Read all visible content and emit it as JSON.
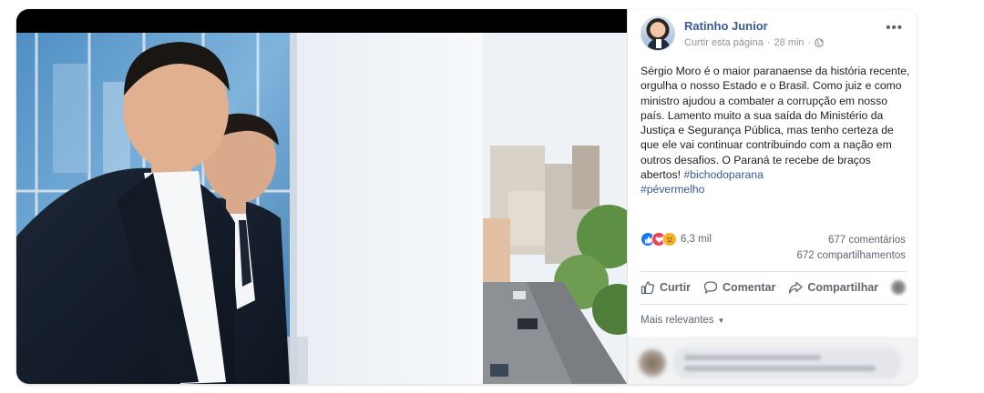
{
  "post": {
    "author": "Ratinho Junior",
    "like_page": "Curtir esta página",
    "separator": "·",
    "time": "28 min",
    "separator2": "·",
    "more_icon": "more-dots-icon",
    "text": "Sérgio Moro é o maior paranaense da história recente, orgulha o nosso Estado e o Brasil. Como juiz e como ministro ajudou a combater a corrupção em nosso país. Lamento muito a sua saída do Ministério da Justiça e Segurança Pública, mas tenho certeza de que ele vai continuar contribuindo com a nação em outros desafios. O Paraná te recebe de braços abertos!",
    "hashtag1": "#bichodoparana",
    "hashtag2": "#pévermelho"
  },
  "reactions": {
    "count": "6,3 mil",
    "icons": [
      "like-icon",
      "love-icon",
      "sad-icon"
    ]
  },
  "stats": {
    "comments": "677 comentários",
    "shares": "672 compartilhamentos"
  },
  "actions": {
    "like": "Curtir",
    "comment": "Comentar",
    "share": "Compartilhar"
  },
  "comments_sort": "Mais relevantes",
  "colors": {
    "link": "#385898",
    "text": "#1c1e21",
    "muted": "#606770",
    "like_blue": "#1877f2",
    "love_red": "#f33e58",
    "sad_yellow": "#f7b125"
  }
}
